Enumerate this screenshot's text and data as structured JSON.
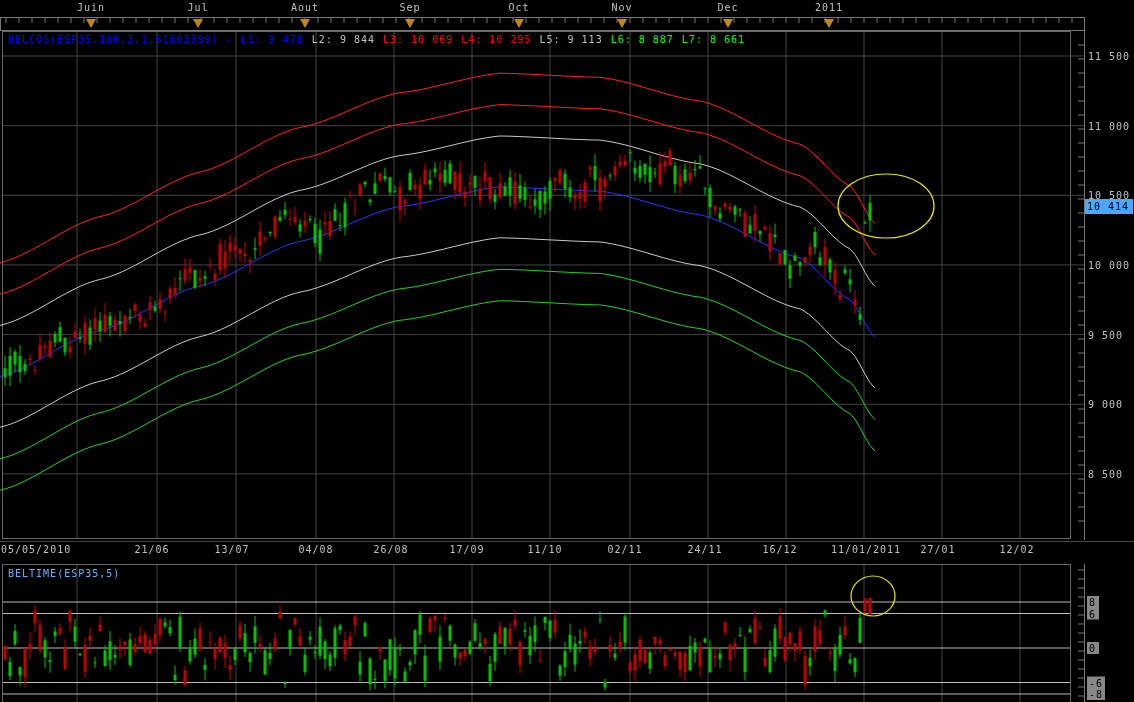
{
  "month_axis": {
    "labels": [
      "Juin",
      "Jul",
      "Aout",
      "Sep",
      "Oct",
      "Nov",
      "Dec",
      "2011"
    ]
  },
  "price_panel": {
    "legend": [
      {
        "text": "BELCOG(ESP35,180,3,1.61803399) -",
        "color": "#0000ff"
      },
      {
        "text": "L1: 9 478",
        "color": "#0000ff"
      },
      {
        "text": "L2: 9 844",
        "color": "#c0c0c0"
      },
      {
        "text": "L3: 10 069",
        "color": "#ff0000"
      },
      {
        "text": "L4: 10 295",
        "color": "#ff0000"
      },
      {
        "text": "L5: 9 113",
        "color": "#c0c0c0"
      },
      {
        "text": "L6: 8 887",
        "color": "#00ff00"
      },
      {
        "text": "L7: 8 661",
        "color": "#00ff00"
      }
    ],
    "y_labels": [
      "11 500",
      "11 000",
      "10 500",
      "10 000",
      "9 500",
      "9 000",
      "8 500"
    ],
    "last_price": "10 414"
  },
  "date_axis": [
    "05/05/2010",
    "21/06",
    "13/07",
    "04/08",
    "26/08",
    "17/09",
    "11/10",
    "02/11",
    "24/11",
    "16/12",
    "11/01/2011",
    "27/01",
    "12/02"
  ],
  "oscillator_panel": {
    "legend": "BELTIME(ESP35,5)",
    "y_labels": [
      "8",
      "6",
      "0",
      "-6",
      "-8"
    ]
  }
}
